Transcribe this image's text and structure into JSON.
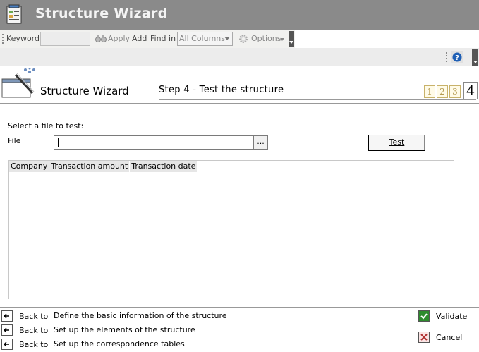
{
  "window": {
    "title": "Structure Wizard"
  },
  "toolbar": {
    "keyword_label": "Keyword",
    "keyword_value": "",
    "apply_label": "Apply",
    "add_label": "Add",
    "find_in_label": "Find in",
    "find_in_selected": "All Columns",
    "options_label": "Options"
  },
  "wizard": {
    "title": "Structure Wizard",
    "step_title": "Step 4 - Test the structure",
    "steps": [
      "1",
      "2",
      "3"
    ],
    "current_step": "4"
  },
  "form": {
    "select_label": "Select a file to test:",
    "file_label": "File",
    "file_value": "",
    "browse_label": "...",
    "test_label": "Test"
  },
  "grid": {
    "columns": [
      "Company",
      "Transaction amount",
      "Transaction date"
    ]
  },
  "footer": {
    "back_label": "Back to",
    "back_items": [
      "Define the basic information of the structure",
      "Set up the elements of the structure",
      "Set up the correspondence tables"
    ],
    "validate_label": "Validate",
    "cancel_label": "Cancel"
  },
  "colors": {
    "titlebar": "#8a8a8a",
    "step_accent": "#c8b26a",
    "validate": "#2e8b2e",
    "cancel": "#b03030"
  }
}
